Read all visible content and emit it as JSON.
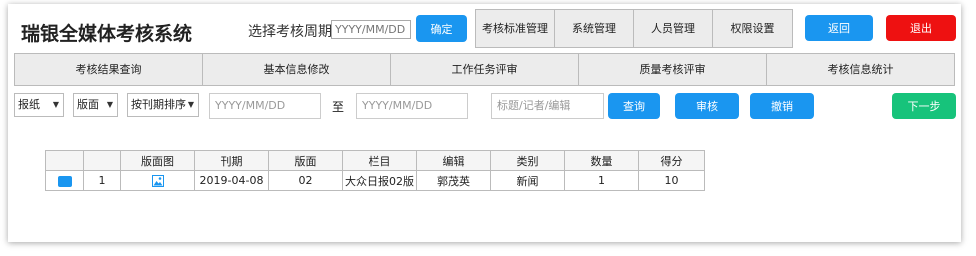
{
  "header": {
    "title": "瑞银全媒体考核系统",
    "period_label": "选择考核周期",
    "date_placeholder": "YYYY/MM/DD",
    "confirm_label": "确定",
    "back_label": "返回",
    "logout_label": "退出"
  },
  "top_nav": [
    "考核标准管理",
    "系统管理",
    "人员管理",
    "权限设置"
  ],
  "tabs": [
    "考核结果查询",
    "基本信息修改",
    "工作任务评审",
    "质量考核评审",
    "考核信息统计"
  ],
  "filters": {
    "media_select": "报纸",
    "page_select": "版面",
    "sort_select": "按刊期排序",
    "date_from_placeholder": "YYYY/MM/DD",
    "to_label": "至",
    "date_to_placeholder": "YYYY/MM/DD",
    "keyword_placeholder": "标题/记者/编辑",
    "query_label": "查询",
    "review_label": "审核",
    "revoke_label": "撤销",
    "next_label": "下一步"
  },
  "table": {
    "columns": [
      "",
      "",
      "版面图",
      "刊期",
      "版面",
      "栏目",
      "编辑",
      "类别",
      "数量",
      "得分"
    ],
    "rows": [
      {
        "index": "1",
        "date": "2019-04-08",
        "page": "02",
        "column": "大众日报02版",
        "editor": "郭茂英",
        "category": "新闻",
        "count": "1",
        "score": "10"
      }
    ]
  },
  "colors": {
    "primary": "#1a96f0",
    "danger": "#ee1111",
    "success": "#17c37b",
    "nav_bg": "#ececec"
  },
  "icons": {
    "row_checkbox": "checkbox-checked-icon",
    "page_image": "image-icon"
  }
}
